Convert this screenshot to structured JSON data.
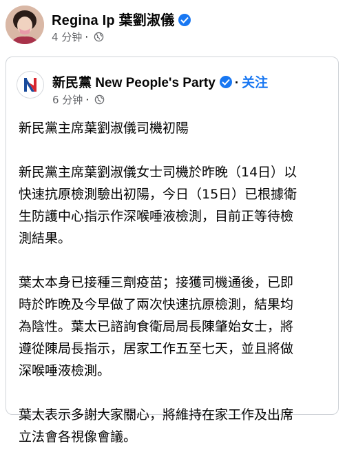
{
  "post": {
    "author": "Regina Ip 葉劉淑儀",
    "time": "4 分钟",
    "verified_icon": "verified-badge-icon",
    "visibility_icon": "globe-icon"
  },
  "shared": {
    "page_name": "新民黨 New People's Party",
    "follow_label": "关注",
    "separator": "·",
    "time": "6 分钟",
    "paragraphs": [
      "新民黨主席葉劉淑儀司機初陽",
      "新民黨主席葉劉淑儀女士司機於昨晚（14日）以\n快速抗原檢測驗出初陽，今日（15日）已根據衛\n生防護中心指示作深喉唾液檢測，目前正等待檢\n測結果。",
      "葉太本身已接種三劑疫苗；接獲司機通後，已即\n時於昨晚及今早做了兩次快速抗原檢測，結果均\n為陰性。葉太已諮詢食衛局局長陳肇始女士，將\n遵從陳局長指示，居家工作五至七天，並且將做\n深喉唾液檢測。",
      "葉太表示多謝大家關心，將維持在家工作及出席\n立法會各視像會議。"
    ]
  },
  "colors": {
    "accent": "#1877f2",
    "meta_text": "#65676b",
    "logo_red": "#d7262e",
    "logo_blue": "#1a4b9c"
  }
}
